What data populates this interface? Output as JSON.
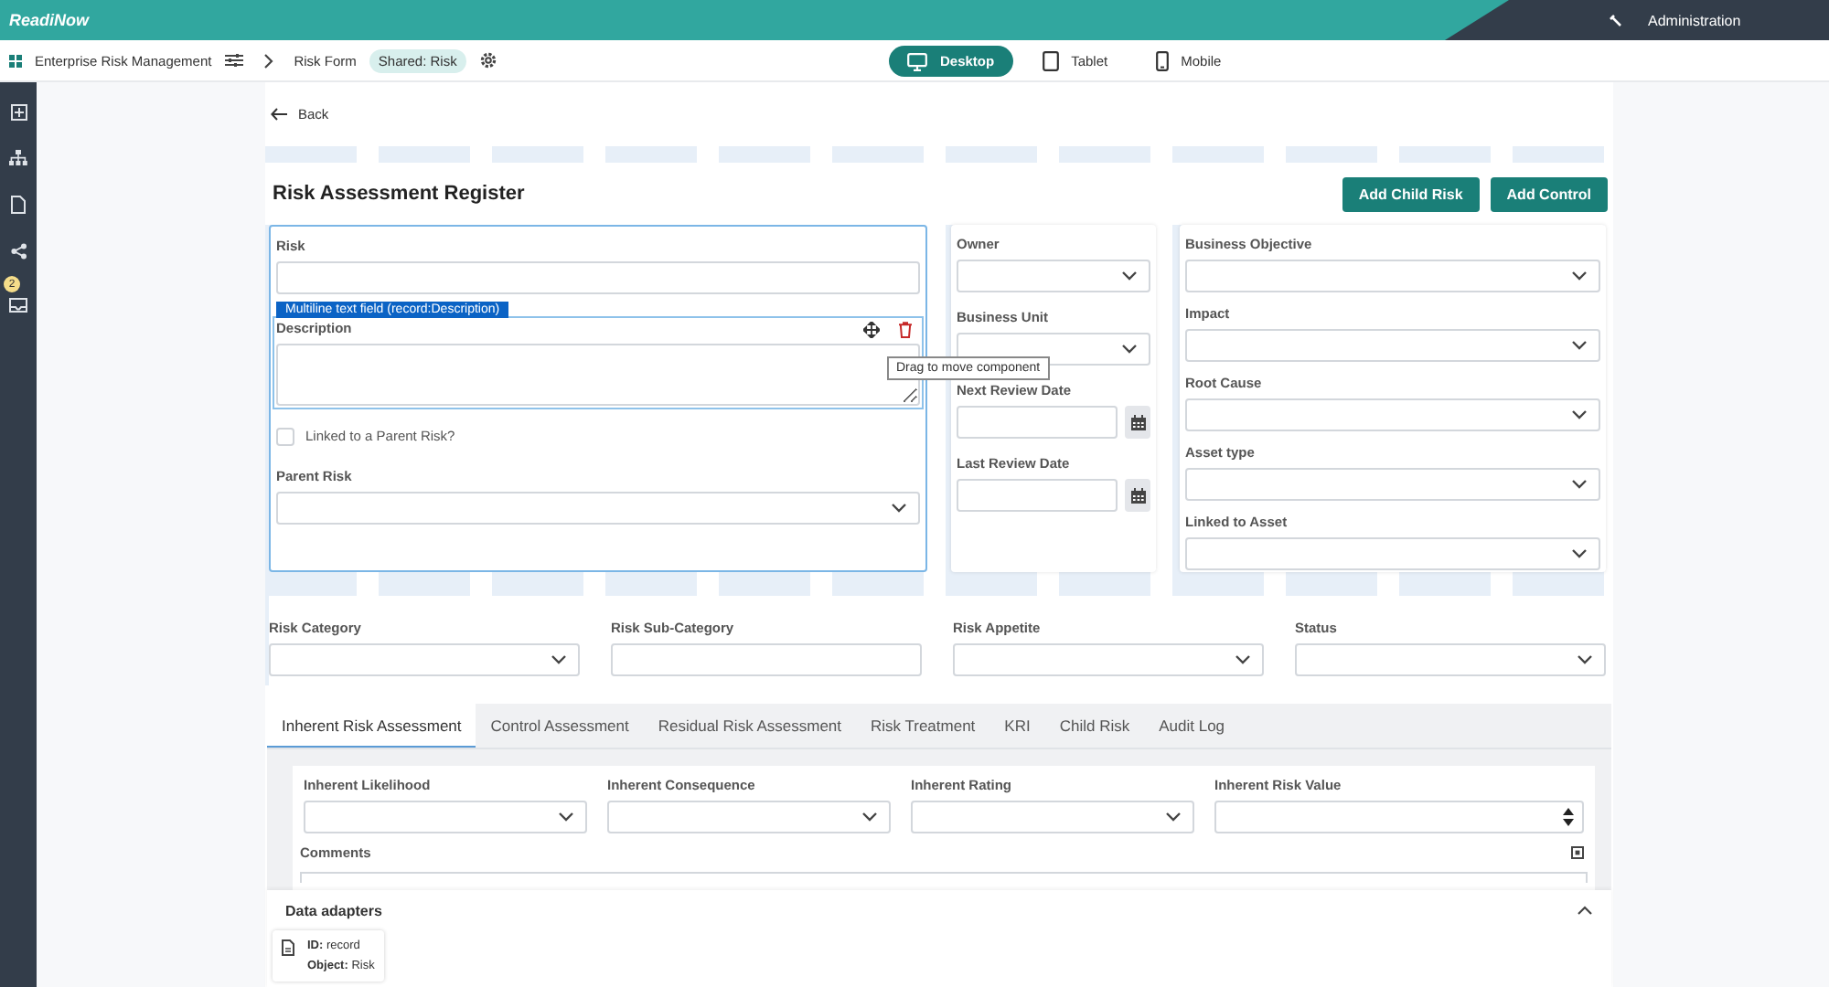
{
  "header": {
    "logo": "ReadiNow",
    "admin": "Administration"
  },
  "breadcrumb": {
    "app": "Enterprise Risk Management",
    "form": "Risk Form",
    "chip": "Shared: Risk"
  },
  "devices": [
    {
      "label": "Desktop",
      "selected": true
    },
    {
      "label": "Tablet",
      "selected": false
    },
    {
      "label": "Mobile",
      "selected": false
    }
  ],
  "sidebar": {
    "badge": "2"
  },
  "back": "Back",
  "title": "Risk Assessment Register",
  "actions": [
    "Add Child Risk",
    "Add Control"
  ],
  "form": {
    "cards": [
      {
        "selected": true,
        "fields": [
          {
            "kind": "text",
            "label": "Risk",
            "selected": false
          },
          {
            "kind": "textarea",
            "label": "Description",
            "selected": true
          },
          {
            "kind": "checkbox",
            "label": "Linked to a Parent Risk?",
            "checked": false,
            "selected": false
          },
          {
            "kind": "dropdown",
            "label": "Parent Risk",
            "selected": false
          }
        ]
      },
      {
        "selected": false,
        "fields": [
          {
            "kind": "dropdown",
            "label": "Owner",
            "selected": false
          },
          {
            "kind": "dropdown",
            "label": "Business Unit",
            "selected": false
          },
          {
            "kind": "date",
            "label": "Next Review Date",
            "selected": false
          },
          {
            "kind": "date",
            "label": "Last Review Date",
            "selected": false
          }
        ]
      },
      {
        "selected": false,
        "fields": [
          {
            "kind": "dropdown",
            "label": "Business Objective",
            "selected": false
          },
          {
            "kind": "dropdown",
            "label": "Impact",
            "selected": false
          },
          {
            "kind": "dropdown",
            "label": "Root Cause",
            "selected": false
          },
          {
            "kind": "dropdown",
            "label": "Asset type",
            "selected": false
          },
          {
            "kind": "dropdown",
            "label": "Linked to Asset",
            "selected": false
          }
        ]
      }
    ],
    "row": [
      {
        "kind": "dropdown",
        "label": "Risk Category"
      },
      {
        "kind": "text",
        "label": "Risk Sub-Category"
      },
      {
        "kind": "dropdown",
        "label": "Risk Appetite"
      },
      {
        "kind": "dropdown",
        "label": "Status"
      }
    ]
  },
  "selection": {
    "label": "Multiline text field (record:Description)",
    "tooltip": "Drag to move component"
  },
  "tabs": [
    {
      "label": "Inherent Risk Assessment",
      "selected": true
    },
    {
      "label": "Control Assessment",
      "selected": false
    },
    {
      "label": "Residual Risk Assessment",
      "selected": false
    },
    {
      "label": "Risk Treatment",
      "selected": false
    },
    {
      "label": "KRI",
      "selected": false
    },
    {
      "label": "Child Risk",
      "selected": false
    },
    {
      "label": "Audit Log",
      "selected": false
    }
  ],
  "tab_fields": [
    {
      "kind": "dropdown",
      "label": "Inherent Likelihood"
    },
    {
      "kind": "dropdown",
      "label": "Inherent Consequence"
    },
    {
      "kind": "dropdown",
      "label": "Inherent Rating"
    },
    {
      "kind": "number",
      "label": "Inherent Risk Value"
    }
  ],
  "comments": {
    "label": "Comments"
  },
  "adapters": {
    "title": "Data adapters",
    "expanded": true,
    "items": [
      {
        "id": "**ID:** record",
        "object": "**Object:** Risk"
      }
    ]
  }
}
